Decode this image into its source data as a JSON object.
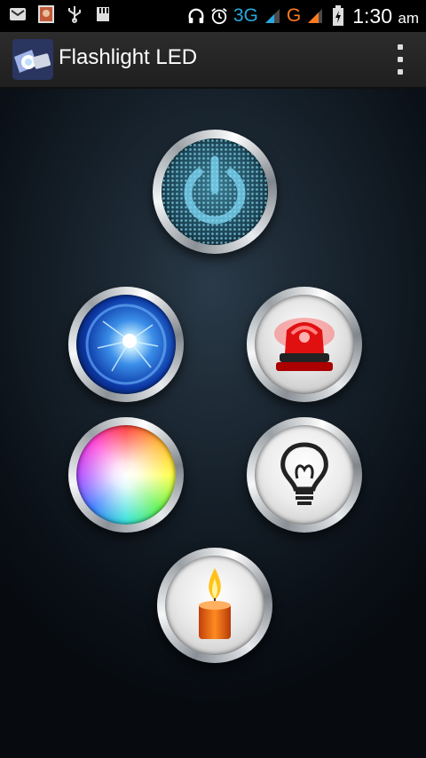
{
  "status_bar": {
    "network_3g": "3G",
    "network_g": "G",
    "time": "1:30",
    "ampm": "am",
    "left_icons": [
      "email-icon",
      "photo-icon",
      "usb-icon",
      "sd-card-icon"
    ],
    "right_icons": [
      "headset-icon",
      "alarm-icon",
      "signal-icon",
      "battery-charging-icon"
    ],
    "accent_3g": "#29a8e0",
    "accent_g": "#ff7a22"
  },
  "action_bar": {
    "title": "Flashlight LED",
    "app_icon": "flashlight-app-icon",
    "menu_icon": "overflow-menu-icon"
  },
  "buttons": [
    {
      "name": "power-button",
      "icon": "power-icon"
    },
    {
      "name": "strobe-button",
      "icon": "lightning-orb-icon"
    },
    {
      "name": "siren-button",
      "icon": "siren-icon"
    },
    {
      "name": "color-light-button",
      "icon": "color-wheel-icon"
    },
    {
      "name": "bulb-button",
      "icon": "light-bulb-icon"
    },
    {
      "name": "candle-button",
      "icon": "candle-icon"
    }
  ]
}
